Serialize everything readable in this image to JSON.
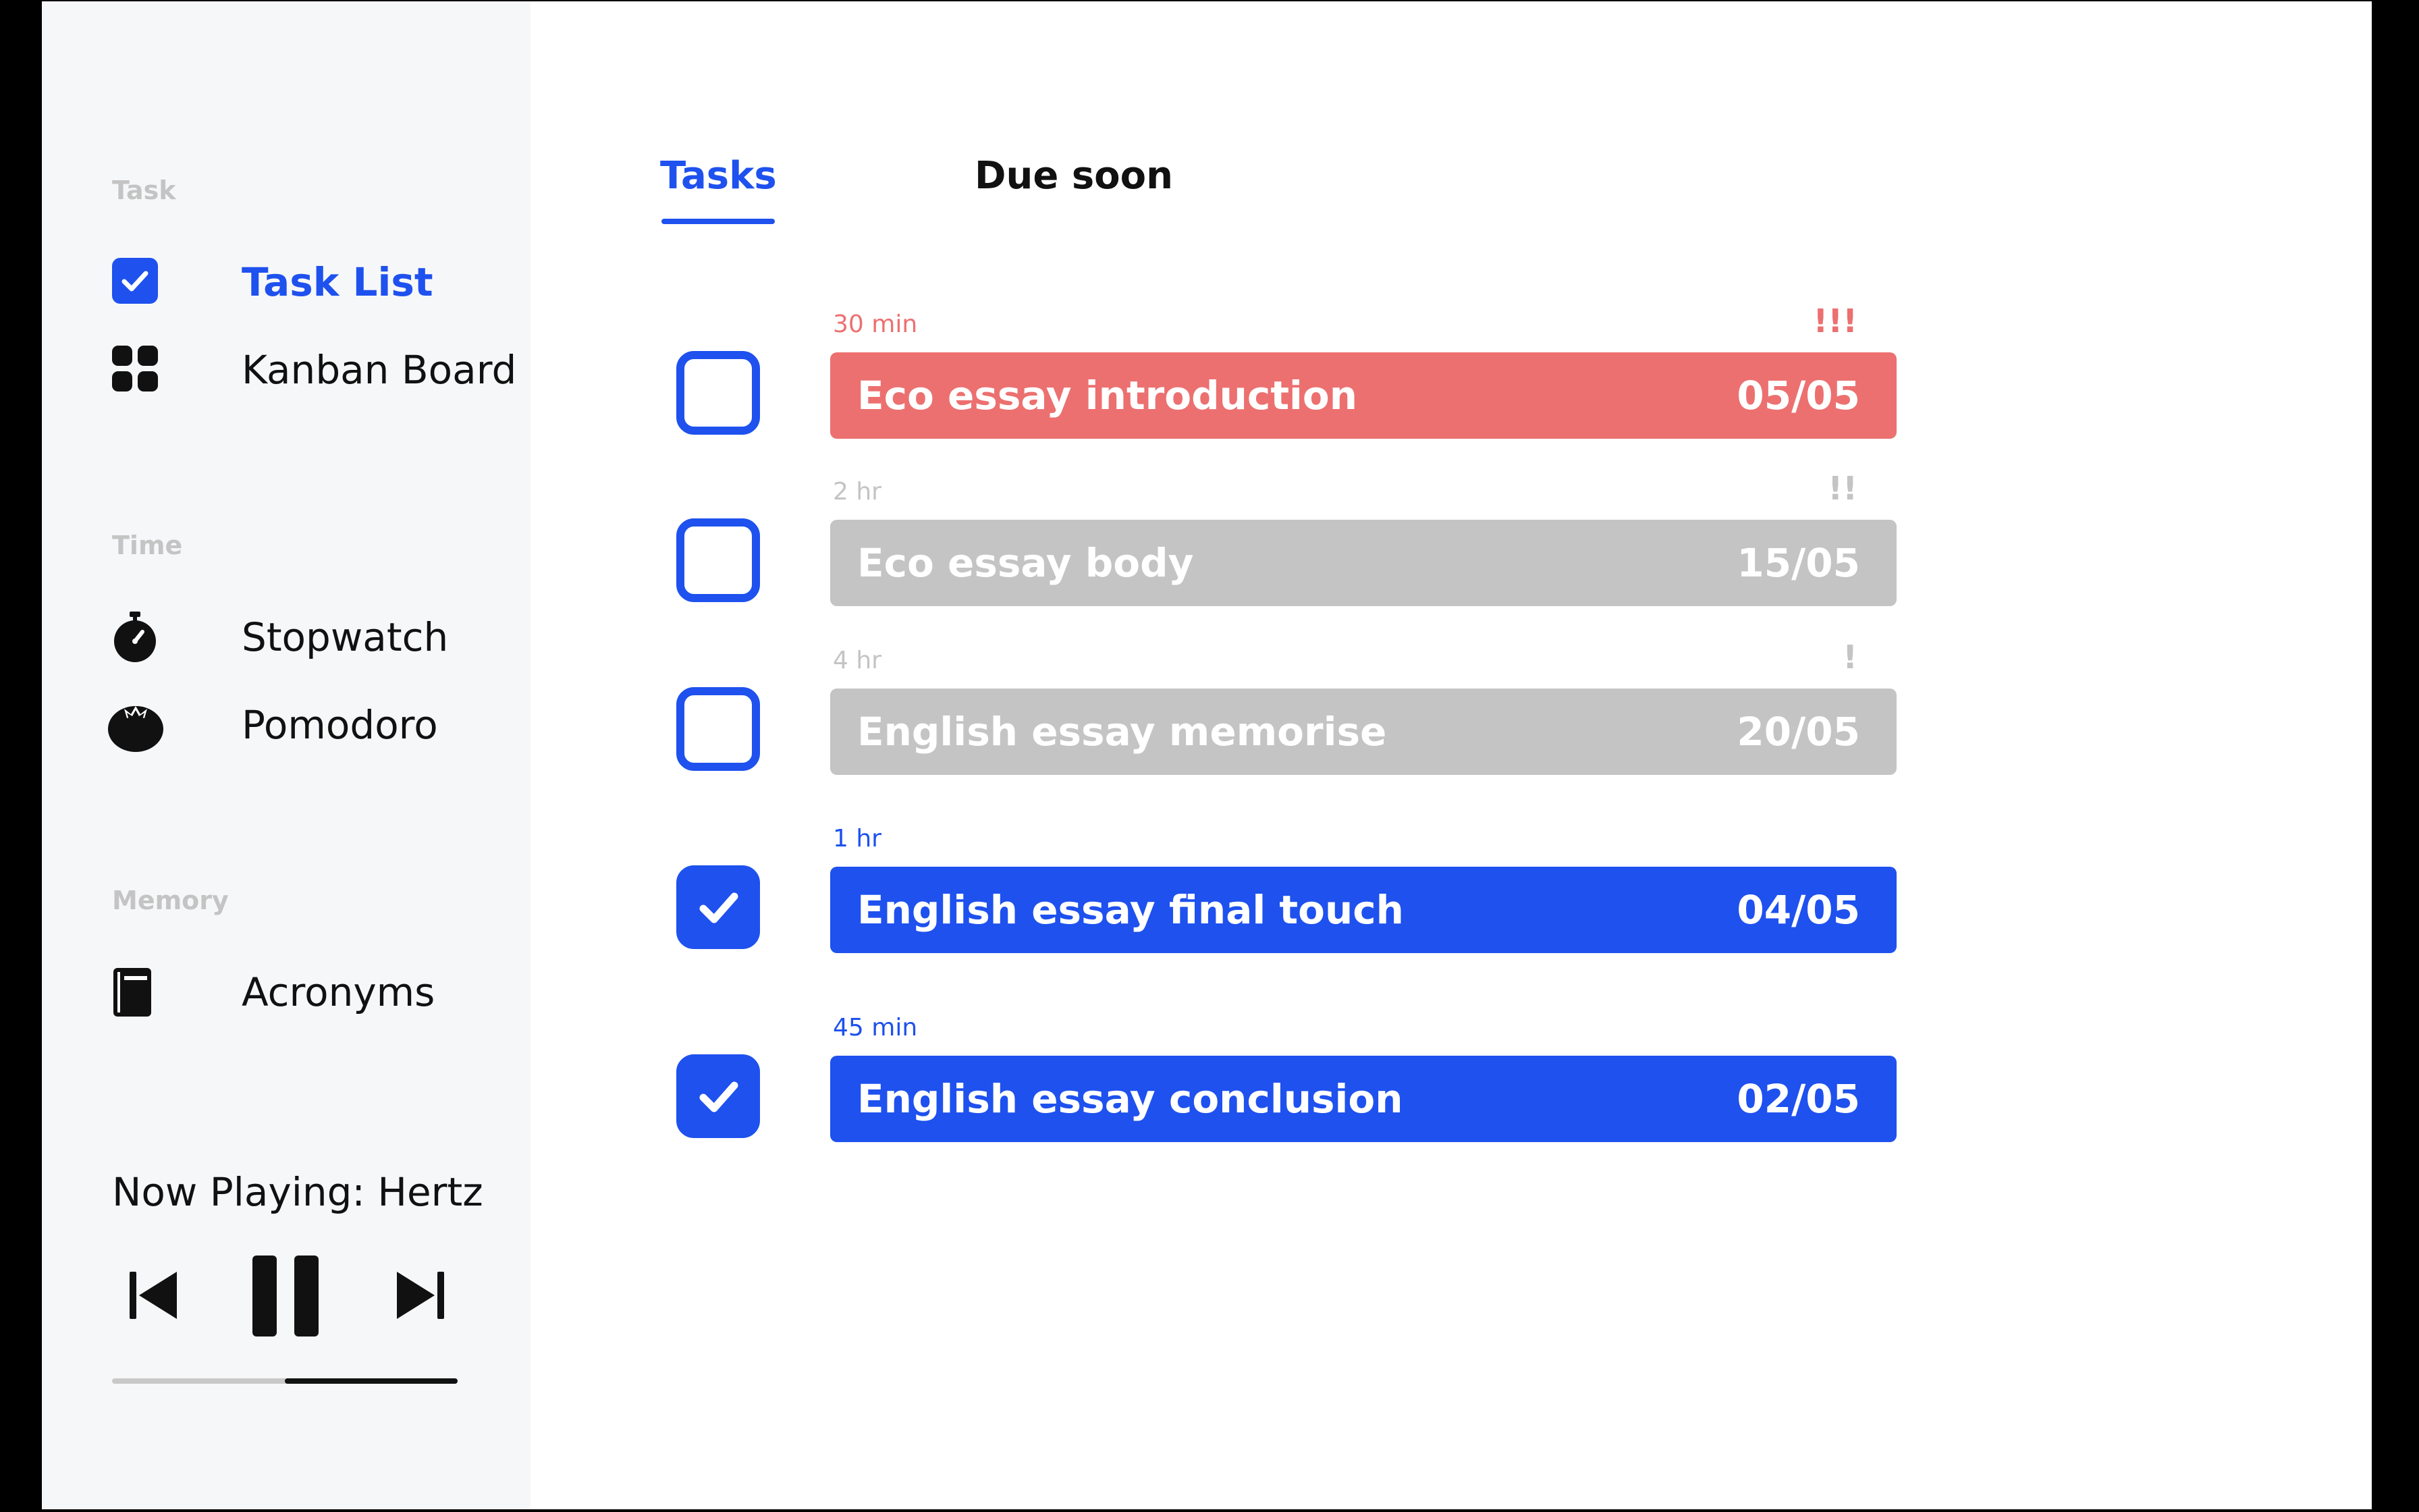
{
  "sidebar": {
    "sections": [
      {
        "label": "Task"
      },
      {
        "label": "Time"
      },
      {
        "label": "Memory"
      }
    ],
    "items": [
      {
        "label": "Task List",
        "icon": "checkbox-icon",
        "active": true
      },
      {
        "label": "Kanban Board",
        "icon": "grid-icon",
        "active": false
      },
      {
        "label": "Stopwatch",
        "icon": "stopwatch-icon",
        "active": false
      },
      {
        "label": "Pomodoro",
        "icon": "tomato-icon",
        "active": false
      },
      {
        "label": "Acronyms",
        "icon": "book-icon",
        "active": false
      }
    ],
    "player": {
      "now_playing": "Now Playing: Hertz",
      "progress": 0.5,
      "controls": [
        "previous-icon",
        "pause-icon",
        "next-icon"
      ]
    }
  },
  "tabs": [
    {
      "label": "Tasks",
      "active": true
    },
    {
      "label": "Due soon",
      "active": false
    }
  ],
  "tasks": [
    {
      "duration": "30 min",
      "priority": "!!!",
      "name": "Eco essay introduction",
      "date": "05/05",
      "checked": false,
      "status": "urgent"
    },
    {
      "duration": "2 hr",
      "priority": "!!",
      "name": "Eco essay body",
      "date": "15/05",
      "checked": false,
      "status": "pending"
    },
    {
      "duration": "4 hr",
      "priority": "!",
      "name": "English essay memorise",
      "date": "20/05",
      "checked": false,
      "status": "pending"
    },
    {
      "duration": "1 hr",
      "priority": "",
      "name": "English essay final touch",
      "date": "04/05",
      "checked": true,
      "status": "done"
    },
    {
      "duration": "45 min",
      "priority": "",
      "name": "English essay conclusion",
      "date": "02/05",
      "checked": true,
      "status": "done"
    }
  ],
  "colors": {
    "accent": "#1e51ee",
    "urgent": "#ec7070",
    "pending": "#c4c4c4",
    "sidebar_bg": "#f6f7f9",
    "section_label": "#c4c4c4"
  }
}
